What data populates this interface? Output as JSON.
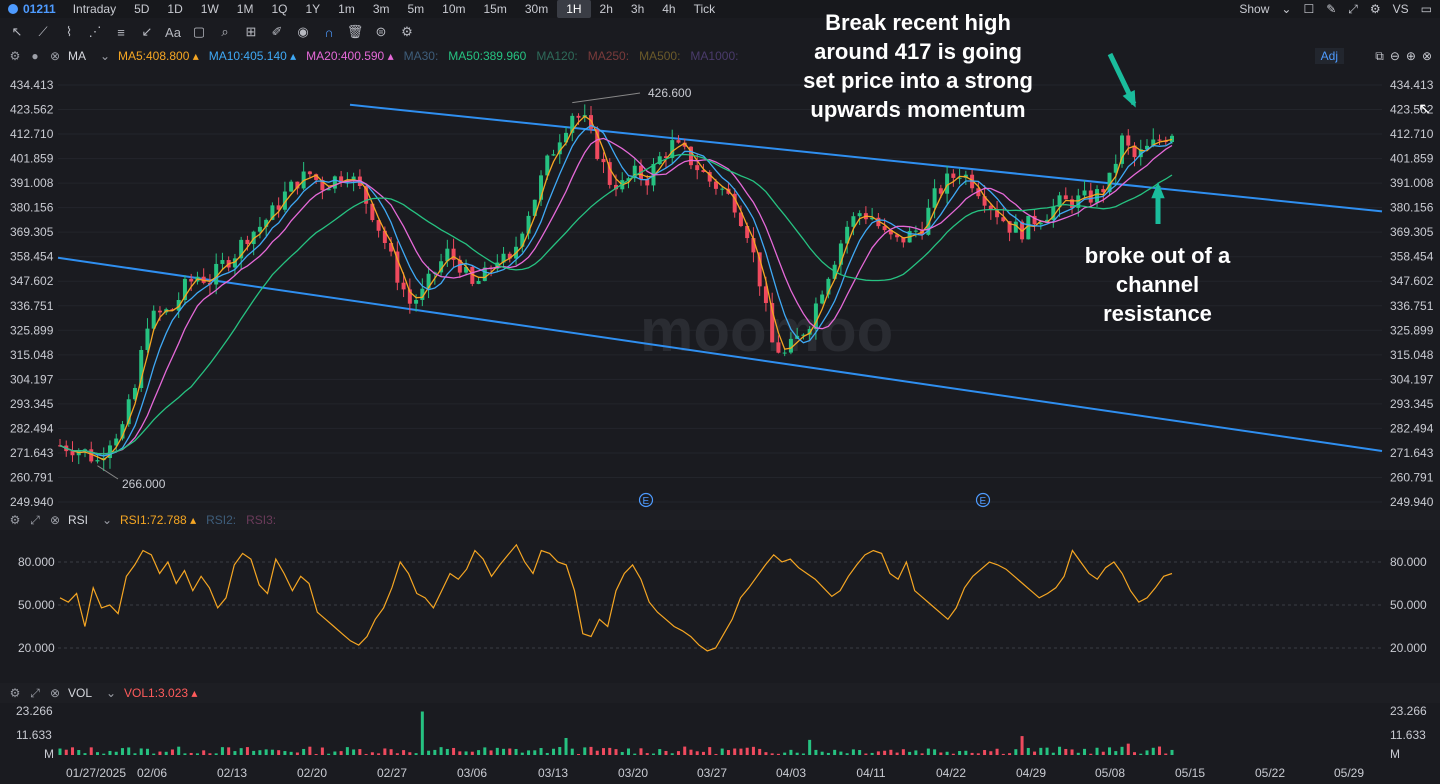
{
  "topbar": {
    "symbol": "01211",
    "timeframes": [
      "Intraday",
      "5D",
      "1D",
      "1W",
      "1M",
      "1Q",
      "1Y",
      "1m",
      "3m",
      "5m",
      "10m",
      "15m",
      "30m",
      "1H",
      "2h",
      "3h",
      "4h",
      "Tick"
    ],
    "active_timeframe": "1H",
    "show_label": "Show",
    "vs_label": "VS"
  },
  "indicators": {
    "ma": {
      "name": "MA",
      "items": [
        {
          "label": "MA5:408.800",
          "color": "#f5a623"
        },
        {
          "label": "MA10:405.140",
          "color": "#3fa9f5"
        },
        {
          "label": "MA20:400.590",
          "color": "#e569d8"
        },
        {
          "label": "MA30:",
          "color": "#3e5d7a"
        },
        {
          "label": "MA50:389.960",
          "color": "#26c281"
        },
        {
          "label": "MA120:",
          "color": "#2e6b5a"
        },
        {
          "label": "MA250:",
          "color": "#7a3b3b"
        },
        {
          "label": "MA500:",
          "color": "#6b5a2a"
        },
        {
          "label": "MA1000:",
          "color": "#4a3b6b"
        }
      ],
      "adj_label": "Adj"
    },
    "rsi": {
      "name": "RSI",
      "items": [
        {
          "label": "RSI1:72.788",
          "color": "#f5a623"
        },
        {
          "label": "RSI2:",
          "color": "#3e5d7a"
        },
        {
          "label": "RSI3:",
          "color": "#6b3b5a"
        }
      ]
    },
    "vol": {
      "name": "VOL",
      "items": [
        {
          "label": "VOL1:3.023",
          "color": "#ff5b5b"
        }
      ]
    }
  },
  "colors": {
    "up": "#26c281",
    "down": "#ef4a5e",
    "channel": "#2f8ff0",
    "arrow": "#1abc9c",
    "rsi_line": "#f5a623"
  },
  "annotations": {
    "top_text": "Break recent high\naround 417 is going\nset price into a strong\nupwards momentum",
    "bottom_text": "broke out of a\nchannel\nresistance",
    "high_label": "426.600",
    "low_label": "266.000",
    "earnings_marker": "E"
  },
  "watermark": "moomoo",
  "chart_data": [
    {
      "type": "candlestick",
      "title": "",
      "y_ticks": [
        "434.413",
        "423.562",
        "412.710",
        "401.859",
        "391.008",
        "380.156",
        "369.305",
        "358.454",
        "347.602",
        "336.751",
        "325.899",
        "315.048",
        "304.197",
        "293.345",
        "282.494",
        "271.643",
        "260.791",
        "249.940"
      ],
      "x_ticks": [
        "01/27/2025",
        "02/06",
        "02/13",
        "02/20",
        "02/27",
        "03/06",
        "03/13",
        "03/20",
        "03/27",
        "04/03",
        "04/11",
        "04/22",
        "04/29",
        "05/08",
        "05/15",
        "05/22",
        "05/29"
      ],
      "ylim": [
        249.94,
        439.0
      ],
      "close_path": [
        [
          0,
          275
        ],
        [
          2,
          274
        ],
        [
          4,
          272
        ],
        [
          6,
          268
        ],
        [
          8,
          278
        ],
        [
          10,
          283
        ],
        [
          12,
          300
        ],
        [
          14,
          330
        ],
        [
          16,
          333
        ],
        [
          18,
          335
        ],
        [
          20,
          345
        ],
        [
          22,
          350
        ],
        [
          24,
          348
        ],
        [
          26,
          355
        ],
        [
          28,
          360
        ],
        [
          30,
          368
        ],
        [
          32,
          372
        ],
        [
          34,
          378
        ],
        [
          36,
          386
        ],
        [
          38,
          392
        ],
        [
          40,
          395
        ],
        [
          42,
          390
        ],
        [
          44,
          393
        ],
        [
          46,
          396
        ],
        [
          48,
          388
        ],
        [
          50,
          378
        ],
        [
          52,
          365
        ],
        [
          54,
          350
        ],
        [
          56,
          338
        ],
        [
          58,
          342
        ],
        [
          60,
          352
        ],
        [
          62,
          360
        ],
        [
          64,
          355
        ],
        [
          66,
          345
        ],
        [
          68,
          350
        ],
        [
          70,
          358
        ],
        [
          72,
          355
        ],
        [
          74,
          372
        ],
        [
          76,
          385
        ],
        [
          78,
          400
        ],
        [
          80,
          412
        ],
        [
          82,
          422
        ],
        [
          84,
          418
        ],
        [
          86,
          405
        ],
        [
          88,
          392
        ],
        [
          90,
          390
        ],
        [
          92,
          395
        ],
        [
          94,
          393
        ],
        [
          96,
          402
        ],
        [
          98,
          408
        ],
        [
          100,
          404
        ],
        [
          102,
          398
        ],
        [
          104,
          392
        ],
        [
          106,
          388
        ],
        [
          108,
          382
        ],
        [
          110,
          370
        ],
        [
          112,
          348
        ],
        [
          114,
          320
        ],
        [
          116,
          315
        ],
        [
          118,
          322
        ],
        [
          120,
          330
        ],
        [
          122,
          345
        ],
        [
          124,
          358
        ],
        [
          126,
          372
        ],
        [
          128,
          378
        ],
        [
          130,
          376
        ],
        [
          132,
          368
        ],
        [
          134,
          365
        ],
        [
          136,
          368
        ],
        [
          138,
          372
        ],
        [
          140,
          385
        ],
        [
          142,
          392
        ],
        [
          144,
          396
        ],
        [
          146,
          392
        ],
        [
          148,
          385
        ],
        [
          150,
          378
        ],
        [
          152,
          372
        ],
        [
          154,
          370
        ],
        [
          156,
          375
        ],
        [
          158,
          378
        ],
        [
          160,
          382
        ],
        [
          162,
          383
        ],
        [
          164,
          384
        ],
        [
          166,
          386
        ],
        [
          168,
          392
        ],
        [
          170,
          410
        ],
        [
          172,
          402
        ],
        [
          174,
          406
        ],
        [
          176,
          410
        ],
        [
          178,
          414
        ]
      ],
      "ma_note": "MA5, MA10, MA20, MA50 overlay lines",
      "high": 426.6,
      "low": 266.0,
      "channel_upper": [
        [
          0,
          439.0
        ],
        [
          200,
          378.5
        ]
      ],
      "channel_lower": [
        [
          0,
          358.0
        ],
        [
          200,
          272.5
        ]
      ]
    },
    {
      "type": "line",
      "title": "",
      "name": "RSI1",
      "y_ticks": [
        "80.000",
        "50.000",
        "20.000"
      ],
      "ylim": [
        0,
        100
      ],
      "values": [
        55,
        52,
        58,
        35,
        62,
        48,
        50,
        44,
        70,
        78,
        88,
        85,
        72,
        80,
        65,
        74,
        60,
        70,
        62,
        48,
        55,
        78,
        86,
        82,
        64,
        58,
        82,
        72,
        60,
        70,
        65,
        45,
        40,
        35,
        30,
        25,
        22,
        28,
        40,
        48,
        62,
        80,
        72,
        58,
        55,
        48,
        60,
        72,
        68,
        75,
        88,
        82,
        70,
        78,
        85,
        92,
        80,
        72,
        88,
        86,
        80,
        78,
        60,
        30,
        28,
        40,
        35,
        60,
        72,
        78,
        68,
        52,
        45,
        40,
        35,
        32,
        28,
        22,
        18,
        20,
        30,
        40,
        55,
        62,
        70,
        78,
        85,
        80,
        82,
        76,
        72,
        68,
        62,
        56,
        60,
        70,
        78,
        85,
        88,
        86,
        72,
        68,
        80,
        60,
        55,
        50,
        45,
        40,
        48,
        62,
        70,
        75,
        80,
        78,
        75,
        70,
        65,
        60,
        55,
        58,
        62,
        70,
        88,
        80,
        72,
        68,
        76,
        80,
        72,
        60,
        52,
        55,
        62,
        70,
        72
      ]
    },
    {
      "type": "bar",
      "title": "",
      "name": "VOL1",
      "y_ticks": [
        "23.266",
        "11.633",
        "M"
      ],
      "ylim": [
        0,
        23.266
      ]
    }
  ]
}
